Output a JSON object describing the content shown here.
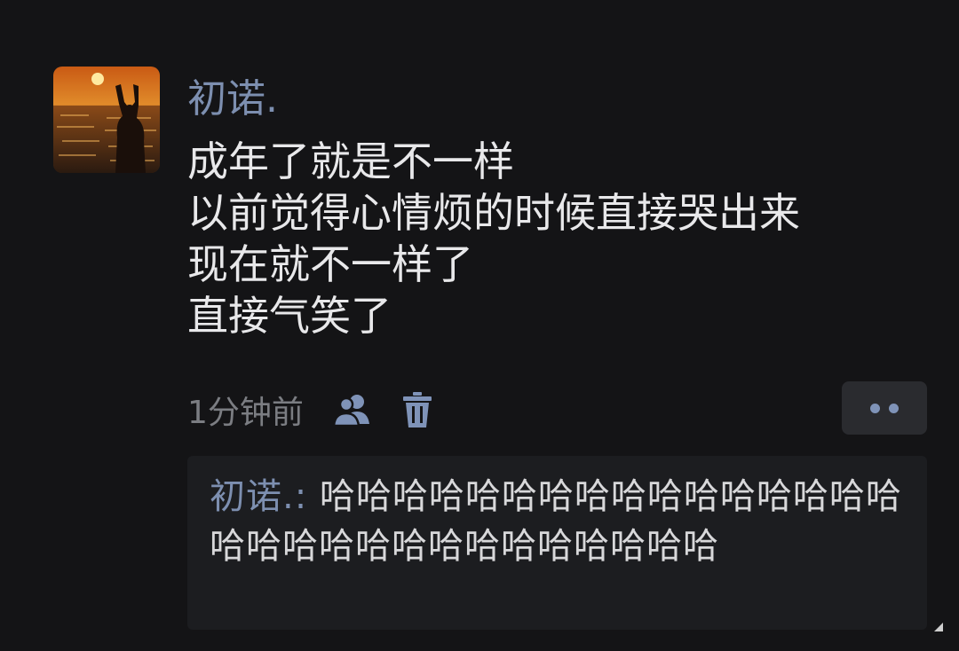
{
  "post": {
    "avatar_icon": "avatar-sunset-photo",
    "username": "初诺.",
    "content_lines": [
      "成年了就是不一样",
      "以前觉得心情烦的时候直接哭出来",
      "现在就不一样了",
      "直接气笑了"
    ],
    "time": "1分钟前",
    "icons": {
      "visibility": "friends-icon",
      "delete": "trash-icon",
      "more": "more-dots-icon"
    }
  },
  "comments": [
    {
      "author": "初诺.",
      "separator": ": ",
      "text": "哈哈哈哈哈哈哈哈哈哈哈哈哈哈哈哈哈哈哈哈哈哈哈哈哈哈哈哈哈哈"
    }
  ],
  "colors": {
    "background": "#141416",
    "username": "#7d8fb0",
    "text": "#e8e8ea",
    "meta": "#7b7d82",
    "comment_panel": "#1c1d20",
    "accent": "#7f93b8"
  }
}
